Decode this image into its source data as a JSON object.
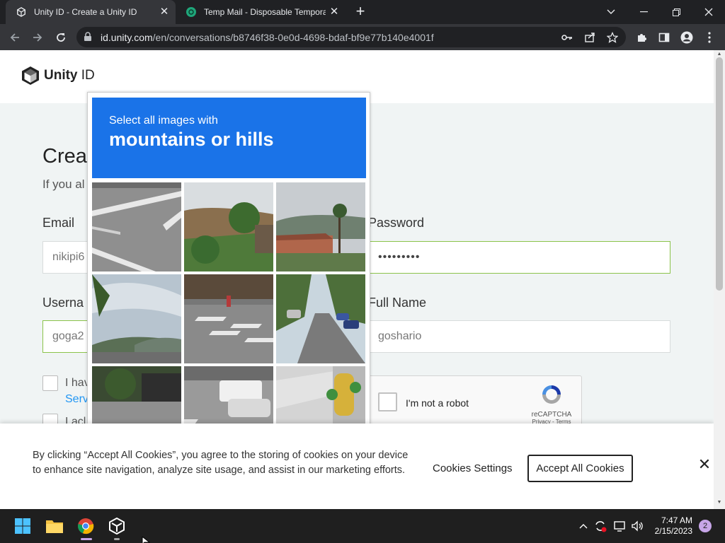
{
  "browser": {
    "tabs": [
      {
        "title": "Unity ID - Create a Unity ID",
        "active": true
      },
      {
        "title": "Temp Mail - Disposable Temporary Email",
        "active": false
      }
    ],
    "new_tab": "+",
    "url_host": "id.unity.com",
    "url_path": "/en/conversations/b8746f38-0e0d-4698-bdaf-bf9e77b140e4001f"
  },
  "header": {
    "logo_bold": "Unity",
    "logo_light": " ID"
  },
  "form": {
    "heading": "Crea",
    "subhead": "If you al",
    "email_label": "Email",
    "email_value": "nikipi6",
    "password_label": "Password",
    "password_value": "•••••••••",
    "username_label": "Userna",
    "username_value": "goga2",
    "fullname_label": "Full Name",
    "fullname_value": "goshario",
    "terms_text": "I hav",
    "terms_link": "Serv",
    "marketing_text": "I acl"
  },
  "recaptcha": {
    "label": "I'm not a robot",
    "brand": "reCAPTCHA",
    "links": "Privacy - Terms"
  },
  "challenge": {
    "line1": "Select all images with",
    "line2": "mountains or hills"
  },
  "cookie": {
    "message": "By clicking “Accept All Cookies”, you agree to the storing of cookies on your device to enhance site navigation, analyze site usage, and assist in our marketing efforts.",
    "settings": "Cookies Settings",
    "accept": "Accept All Cookies",
    "close": "✕"
  },
  "taskbar": {
    "time": "7:47 AM",
    "date": "2/15/2023",
    "notifications": "2"
  },
  "colors": {
    "challenge_blue": "#1a73e8",
    "valid_green": "#8bc34a",
    "link_blue": "#2196f3"
  }
}
